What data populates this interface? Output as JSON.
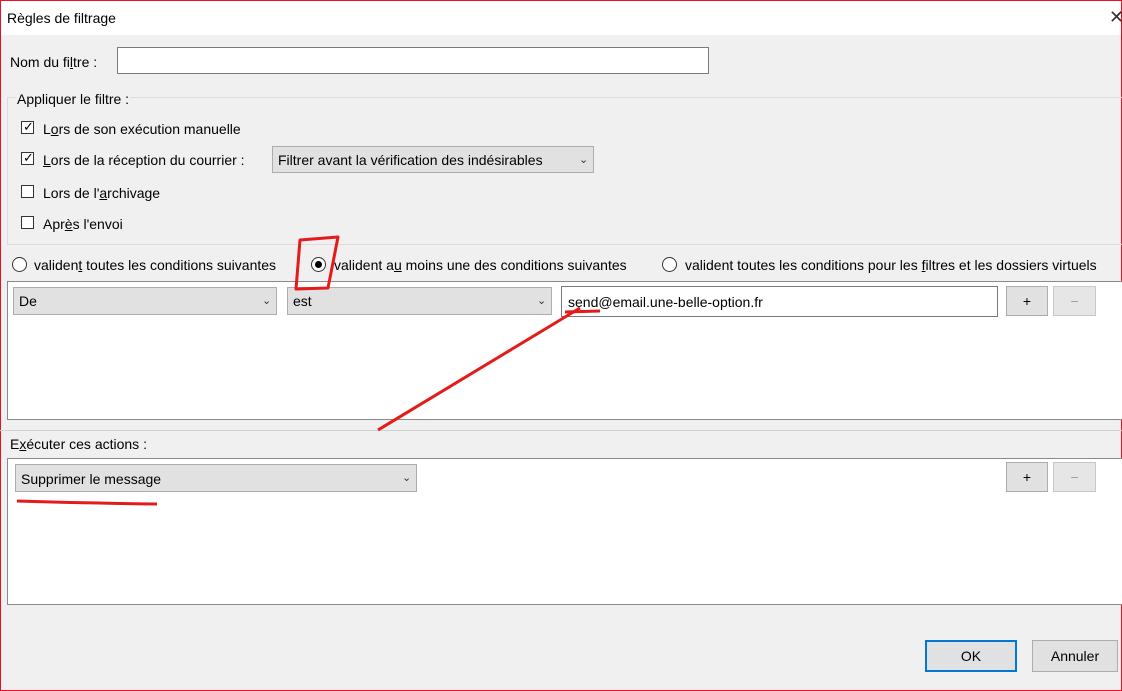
{
  "window": {
    "title": "Règles de filtrage",
    "close_glyph": "✕"
  },
  "filter_name": {
    "label": "Nom du filtre :",
    "value": "",
    "placeholder": ""
  },
  "apply_group": {
    "legend": "Appliquer le filtre :",
    "options": [
      {
        "label": "Lors de son exécution manuelle",
        "checked": true
      },
      {
        "label": "Lors de la réception du courrier :",
        "checked": true
      },
      {
        "label": "Lors de l'archivage",
        "checked": false
      },
      {
        "label": "Après l'envoi",
        "checked": false
      }
    ],
    "timing_select": "Filtrer avant la vérification des indésirables"
  },
  "match_mode": {
    "options": [
      {
        "label": "valident toutes les conditions suivantes",
        "selected": false
      },
      {
        "label": "valident au moins une des conditions suivantes",
        "selected": true
      },
      {
        "label": "valident toutes les conditions pour les filtres et les dossiers virtuels",
        "selected": false
      }
    ]
  },
  "condition_row": {
    "field": "De",
    "operator": "est",
    "value": "send@email.une-belle-option.fr",
    "add_label": "+",
    "remove_label": "−"
  },
  "actions": {
    "legend": "Exécuter ces actions :",
    "action_select": "Supprimer le message",
    "add_label": "+",
    "remove_label": "−"
  },
  "footer": {
    "ok_label": "OK",
    "cancel_label": "Annuler"
  },
  "glyphs": {
    "check": "✓",
    "chevron": "⌄"
  },
  "annotation_color": "#e51b1b"
}
